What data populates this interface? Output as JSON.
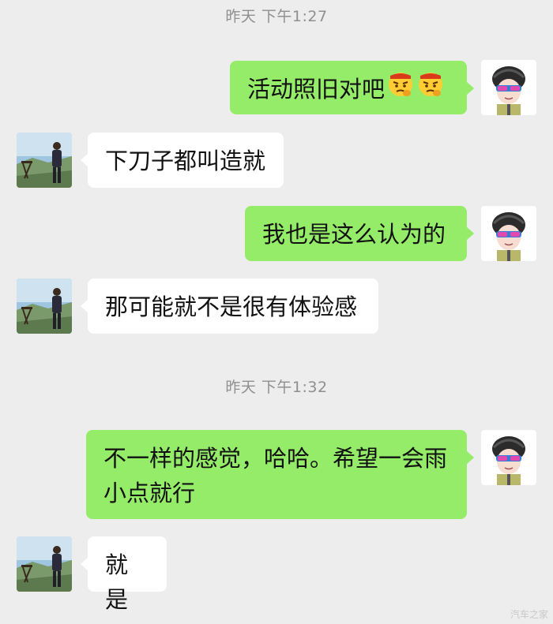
{
  "timestamps": [
    "昨天 下午1:27",
    "昨天 下午1:32"
  ],
  "messages": [
    {
      "side": "out",
      "text": "活动照旧对吧",
      "emojis": [
        "angry-face-emoji",
        "angry-face-emoji"
      ]
    },
    {
      "side": "in",
      "text": "下刀子都叫造就"
    },
    {
      "side": "out",
      "text": "我也是这么认为的"
    },
    {
      "side": "in",
      "text": "那可能就不是很有体验感"
    },
    {
      "side": "out",
      "text": "不一样的感觉，哈哈。希望一会雨小点就行"
    },
    {
      "side": "in",
      "text": "就是"
    }
  ],
  "avatars": {
    "self": "helmet-cartoon-avatar",
    "other": "outdoor-photo-avatar"
  },
  "colors": {
    "background": "#ededed",
    "outgoing_bubble": "#95ec69",
    "incoming_bubble": "#ffffff",
    "timestamp_text": "#8f8f8f"
  },
  "watermark": "汽车之家"
}
